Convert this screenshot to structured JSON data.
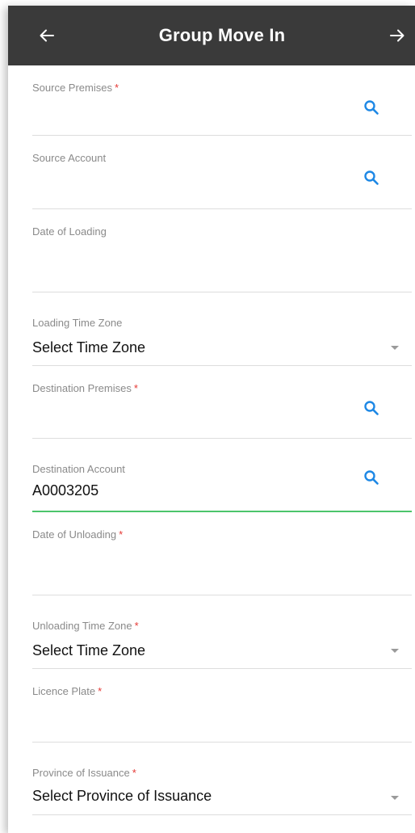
{
  "appbar": {
    "title": "Group Move In"
  },
  "colors": {
    "appbar_bg": "#3a3a3a",
    "accent_blue": "#1e88e5",
    "required_red": "#e53935",
    "active_underline": "#4cc56b"
  },
  "fields": {
    "source_premises": {
      "label": "Source Premises",
      "required": "*"
    },
    "source_account": {
      "label": "Source Account"
    },
    "date_of_loading": {
      "label": "Date of Loading"
    },
    "loading_time_zone": {
      "label": "Loading Time Zone",
      "value": "Select Time Zone"
    },
    "destination_premises": {
      "label": "Destination Premises",
      "required": "*"
    },
    "destination_account": {
      "label": "Destination Account",
      "value": "A0003205"
    },
    "date_of_unloading": {
      "label": "Date of Unloading",
      "required": "*"
    },
    "unloading_time_zone": {
      "label": "Unloading Time Zone",
      "required": "*",
      "value": "Select Time Zone"
    },
    "licence_plate": {
      "label": "Licence Plate",
      "required": "*"
    },
    "province_of_issuance": {
      "label": "Province of Issuance",
      "required": "*",
      "value": "Select Province of Issuance"
    }
  }
}
